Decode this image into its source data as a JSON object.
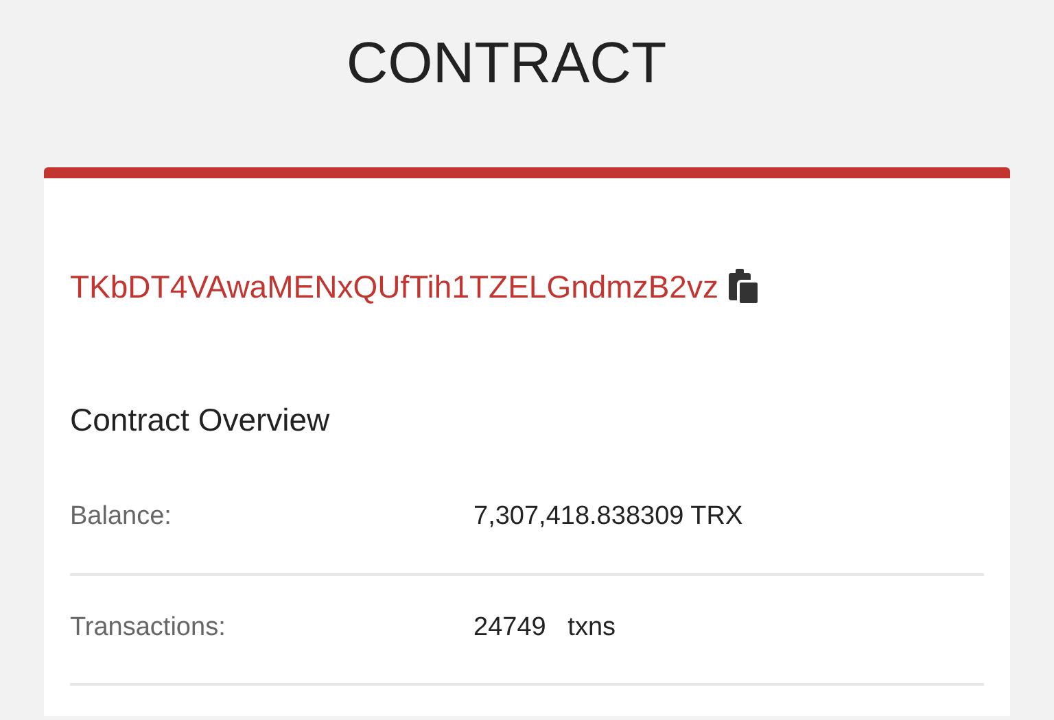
{
  "page_title": "CONTRACT",
  "address": "TKbDT4VAwaMENxQUfTih1TZELGndmzB2vz",
  "section_title": "Contract Overview",
  "rows": [
    {
      "label": "Balance:",
      "value": "7,307,418.838309 TRX"
    },
    {
      "label": "Transactions:",
      "value": "24749   txns"
    }
  ]
}
